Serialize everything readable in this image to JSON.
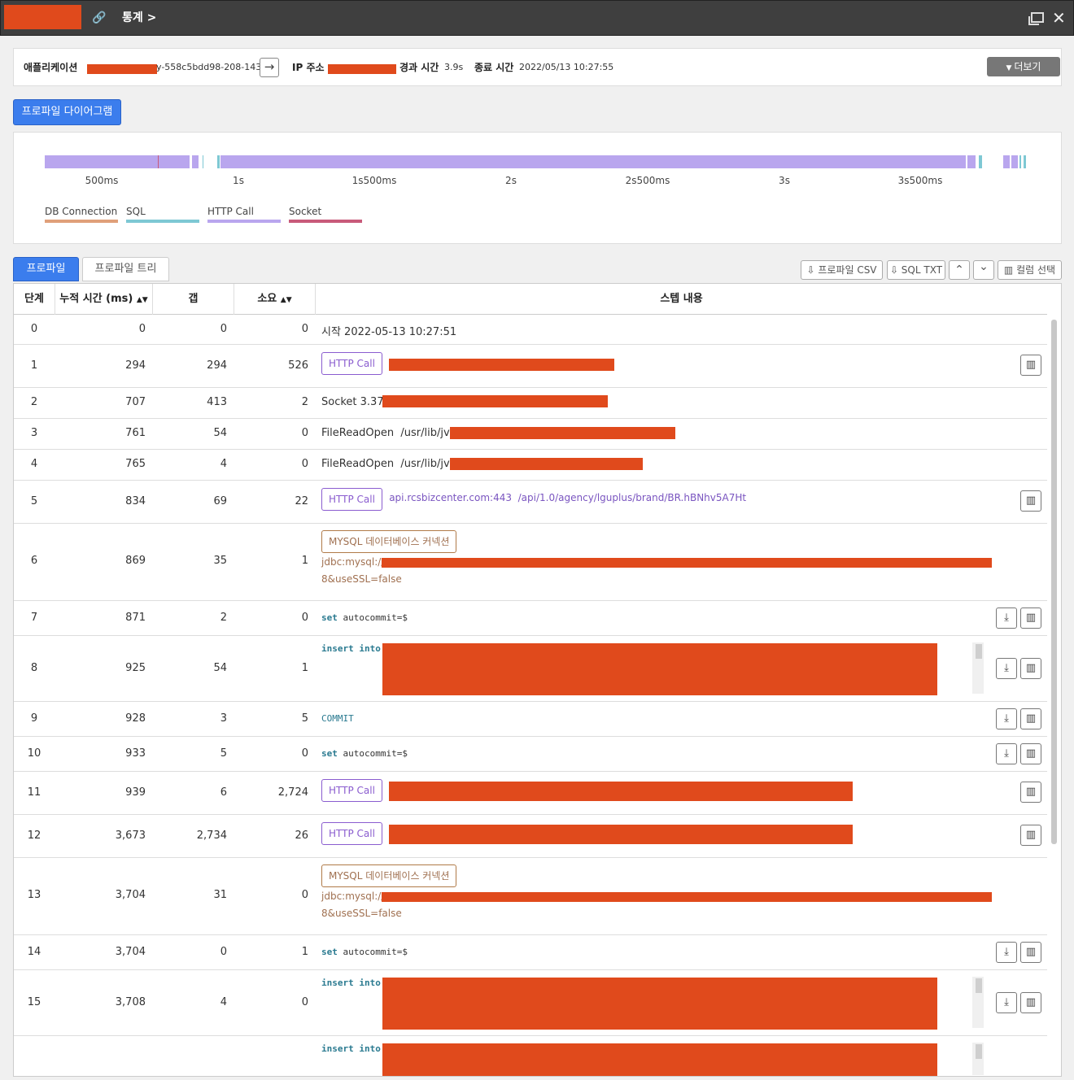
{
  "window": {
    "title": "통계 >"
  },
  "info": {
    "app_label": "애플리케이션",
    "app_value": "y-558c5bdd98-208-143",
    "ip_label": "IP 주소",
    "elapsed_label": "경과 시간",
    "elapsed_value": "3.9s",
    "end_label": "종료 시간",
    "end_value": "2022/05/13 10:27:55",
    "more_label": "더보기"
  },
  "diagram_tab": "프로파일 다이어그램",
  "timeline": {
    "ticks": [
      "500ms",
      "1s",
      "1s500ms",
      "2s",
      "2s500ms",
      "3s",
      "3s500ms"
    ],
    "legend": [
      {
        "label": "DB Connection",
        "color": "#e0a07a"
      },
      {
        "label": "SQL",
        "color": "#7ec8d4"
      },
      {
        "label": "HTTP Call",
        "color": "#b9a6ee"
      },
      {
        "label": "Socket",
        "color": "#c85a7a"
      }
    ]
  },
  "tabs": {
    "profile": "프로파일",
    "tree": "프로파일 트리"
  },
  "toolbar": {
    "csv": "⇩ 프로파일 CSV",
    "sqltxt": "⇩ SQL TXT",
    "up": "⌃",
    "down": "⌄",
    "columns": "▥ 컬럼 선택"
  },
  "table": {
    "headers": {
      "step": "단계",
      "cum": "누적 시간 (ms)",
      "gap": "갭",
      "dur": "소요",
      "content": "스텝 내용"
    },
    "rows": [
      {
        "step": "0",
        "cum": "0",
        "gap": "0",
        "dur": "0",
        "text": "시작 2022-05-13 10:27:51"
      },
      {
        "step": "1",
        "cum": "294",
        "gap": "294",
        "dur": "526",
        "badge": "HTTP Call"
      },
      {
        "step": "2",
        "cum": "707",
        "gap": "413",
        "dur": "2",
        "text": "Socket 3.37."
      },
      {
        "step": "3",
        "cum": "761",
        "gap": "54",
        "dur": "0",
        "text": "FileReadOpen  /usr/lib/jvm/"
      },
      {
        "step": "4",
        "cum": "765",
        "gap": "4",
        "dur": "0",
        "text": "FileReadOpen  /usr/lib/jvm/"
      },
      {
        "step": "5",
        "cum": "834",
        "gap": "69",
        "dur": "22",
        "badge": "HTTP Call",
        "url": "api.rcsbizcenter.com:443  /api/1.0/agency/lguplus/brand/BR.hBNhv5A7Ht"
      },
      {
        "step": "6",
        "cum": "869",
        "gap": "35",
        "dur": "1",
        "badge": "MYSQL 데이터베이스 커넥션",
        "line1": "jdbc:mysql://",
        "line2": "8&useSSL=false"
      },
      {
        "step": "7",
        "cum": "871",
        "gap": "2",
        "dur": "0",
        "kw": "set",
        "sql": " autocommit=$"
      },
      {
        "step": "8",
        "cum": "925",
        "gap": "54",
        "dur": "1",
        "kw": "insert into",
        "sql": ""
      },
      {
        "step": "9",
        "cum": "928",
        "gap": "3",
        "dur": "5",
        "kw": "COMMIT",
        "sql": ""
      },
      {
        "step": "10",
        "cum": "933",
        "gap": "5",
        "dur": "0",
        "kw": "set",
        "sql": " autocommit=$"
      },
      {
        "step": "11",
        "cum": "939",
        "gap": "6",
        "dur": "2,724",
        "badge": "HTTP Call"
      },
      {
        "step": "12",
        "cum": "3,673",
        "gap": "2,734",
        "dur": "26",
        "badge": "HTTP Call"
      },
      {
        "step": "13",
        "cum": "3,704",
        "gap": "31",
        "dur": "0",
        "badge": "MYSQL 데이터베이스 커넥션",
        "line1": "jdbc:mysql://",
        "line2": "8&useSSL=false"
      },
      {
        "step": "14",
        "cum": "3,704",
        "gap": "0",
        "dur": "1",
        "kw": "set",
        "sql": " autocommit=$"
      },
      {
        "step": "15",
        "cum": "3,708",
        "gap": "4",
        "dur": "0",
        "kw": "insert into",
        "sql": ""
      },
      {
        "kw": "insert into"
      }
    ]
  }
}
